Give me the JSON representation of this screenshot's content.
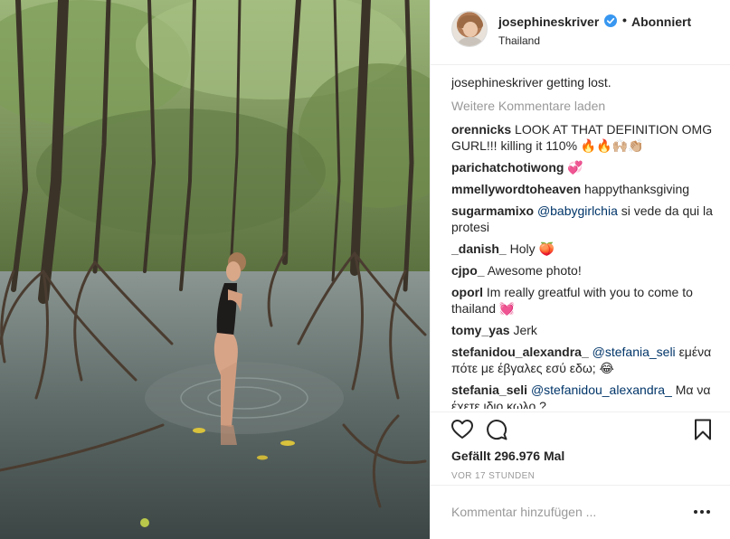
{
  "post": {
    "username": "josephineskriver",
    "follow_status": "Abonniert",
    "separator": "•",
    "location": "Thailand",
    "caption_user": "josephineskriver",
    "caption_text": "getting lost.",
    "load_more": "Weitere Kommentare laden",
    "comments": [
      {
        "user": "orennicks",
        "text": "LOOK AT THAT DEFINITION OMG GURL!!! killing it 110% 🔥🔥🙌🏼👏🏼"
      },
      {
        "user": "parichatchotiwong",
        "text": "💞"
      },
      {
        "user": "mmellywordtoheaven",
        "text": "happythanksgiving"
      },
      {
        "user": "sugarmamixo",
        "mention": "@babygirlchia",
        "text": "si vede da qui la protesi"
      },
      {
        "user": "_danish_",
        "text": "Holy 🍑"
      },
      {
        "user": "cjpo_",
        "text": "Awesome photo!"
      },
      {
        "user": "oporl",
        "text": "Im really greatful with you to come to thailand 💓"
      },
      {
        "user": "tomy_yas",
        "text": "Jerk"
      },
      {
        "user": "stefanidou_alexandra_",
        "mention": "@stefania_seli",
        "text": "εμένα πότε με έβγαλες εσύ εδω; 😂"
      },
      {
        "user": "stefania_seli",
        "mention": "@stefanidou_alexandra_",
        "text": "Μα να έχετε ιδιο κωλο ?"
      }
    ],
    "likes": "Gefällt 296.976 Mal",
    "time_ago": "VOR 17 STUNDEN",
    "comment_placeholder": "Kommentar hinzufügen ..."
  },
  "icons": {
    "like": "heart-icon",
    "comment": "comment-bubble-icon",
    "save": "bookmark-icon",
    "verified": "verified-badge-icon",
    "options": "more-options-icon"
  },
  "colors": {
    "text": "#262626",
    "muted": "#999999",
    "mention": "#003569",
    "verified": "#3897f0",
    "border": "#efefef"
  }
}
